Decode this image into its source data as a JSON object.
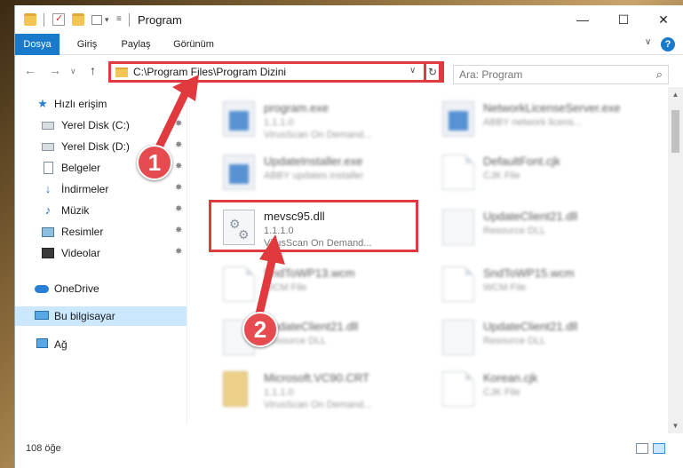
{
  "window": {
    "title": "Program",
    "minimize": "—",
    "maximize": "☐",
    "close": "✕"
  },
  "ribbon": {
    "tabs": [
      "Dosya",
      "Giriş",
      "Paylaş",
      "Görünüm"
    ],
    "expand": "∨",
    "help": "?"
  },
  "nav": {
    "back": "←",
    "forward": "→",
    "recent": "∨",
    "up": "↑",
    "address": "C:\\Program Files\\Program Dizini",
    "address_dropdown": "∨",
    "refresh": "↻",
    "search_placeholder": "Ara: Program",
    "search_icon": "⌕"
  },
  "sidebar": {
    "items": [
      {
        "label": "Hızlı erişim",
        "icon": "star-icon",
        "pinned": false
      },
      {
        "label": "Yerel Disk (C:)",
        "icon": "drive-icon",
        "pinned": true
      },
      {
        "label": "Yerel Disk (D:)",
        "icon": "drive-icon",
        "pinned": true
      },
      {
        "label": "Belgeler",
        "icon": "document-icon",
        "pinned": true
      },
      {
        "label": "İndirmeler",
        "icon": "download-icon",
        "pinned": true
      },
      {
        "label": "Müzik",
        "icon": "music-icon",
        "pinned": true
      },
      {
        "label": "Resimler",
        "icon": "pictures-icon",
        "pinned": true
      },
      {
        "label": "Videolar",
        "icon": "videos-icon",
        "pinned": true
      },
      {
        "label": "OneDrive",
        "icon": "cloud-icon",
        "pinned": false
      },
      {
        "label": "Bu bilgisayar",
        "icon": "computer-icon",
        "pinned": false,
        "selected": true
      },
      {
        "label": "Ağ",
        "icon": "network-icon",
        "pinned": false
      }
    ],
    "pin_glyph": "✸"
  },
  "files": [
    {
      "name": "program.exe",
      "line1": "1.1.1.0",
      "line2": "VirusScan On Demand...",
      "icon": "exe",
      "blurred": true
    },
    {
      "name": "NetworkLicenseServer.exe",
      "line1": "ABBY network licens...",
      "line2": "",
      "icon": "exe",
      "blurred": true
    },
    {
      "name": "UpdateInstaller.exe",
      "line1": "ABBY updates installer",
      "line2": "",
      "icon": "exe",
      "blurred": true
    },
    {
      "name": "DefaultFont.cjk",
      "line1": "CJK File",
      "line2": "",
      "icon": "gen",
      "blurred": true
    },
    {
      "name": "mevsc95.dll",
      "line1": "1.1.1.0",
      "line2": "VirusScan On Demand...",
      "icon": "dll",
      "blurred": false
    },
    {
      "name": "UpdateClient21.dll",
      "line1": "Resource DLL",
      "line2": "",
      "icon": "dll",
      "blurred": true
    },
    {
      "name": "SndToWP13.wcm",
      "line1": "WCM File",
      "line2": "",
      "icon": "gen",
      "blurred": true
    },
    {
      "name": "SndToWP15.wcm",
      "line1": "WCM File",
      "line2": "",
      "icon": "gen",
      "blurred": true
    },
    {
      "name": "UpdateClient21.dll",
      "line1": "Resource DLL",
      "line2": "",
      "icon": "dll",
      "blurred": true
    },
    {
      "name": "UpdateClient21.dll",
      "line1": "Resource DLL",
      "line2": "",
      "icon": "dll",
      "blurred": true
    },
    {
      "name": "Microsoft.VC90.CRT",
      "line1": "1.1.1.0",
      "line2": "VirusScan On Demand...",
      "icon": "folder",
      "blurred": true
    },
    {
      "name": "Korean.cjk",
      "line1": "CJK File",
      "line2": "",
      "icon": "gen",
      "blurred": true
    }
  ],
  "status": {
    "item_count": "108 öğe"
  },
  "annotations": {
    "step1": "1",
    "step2": "2",
    "color": "#e0393e"
  }
}
